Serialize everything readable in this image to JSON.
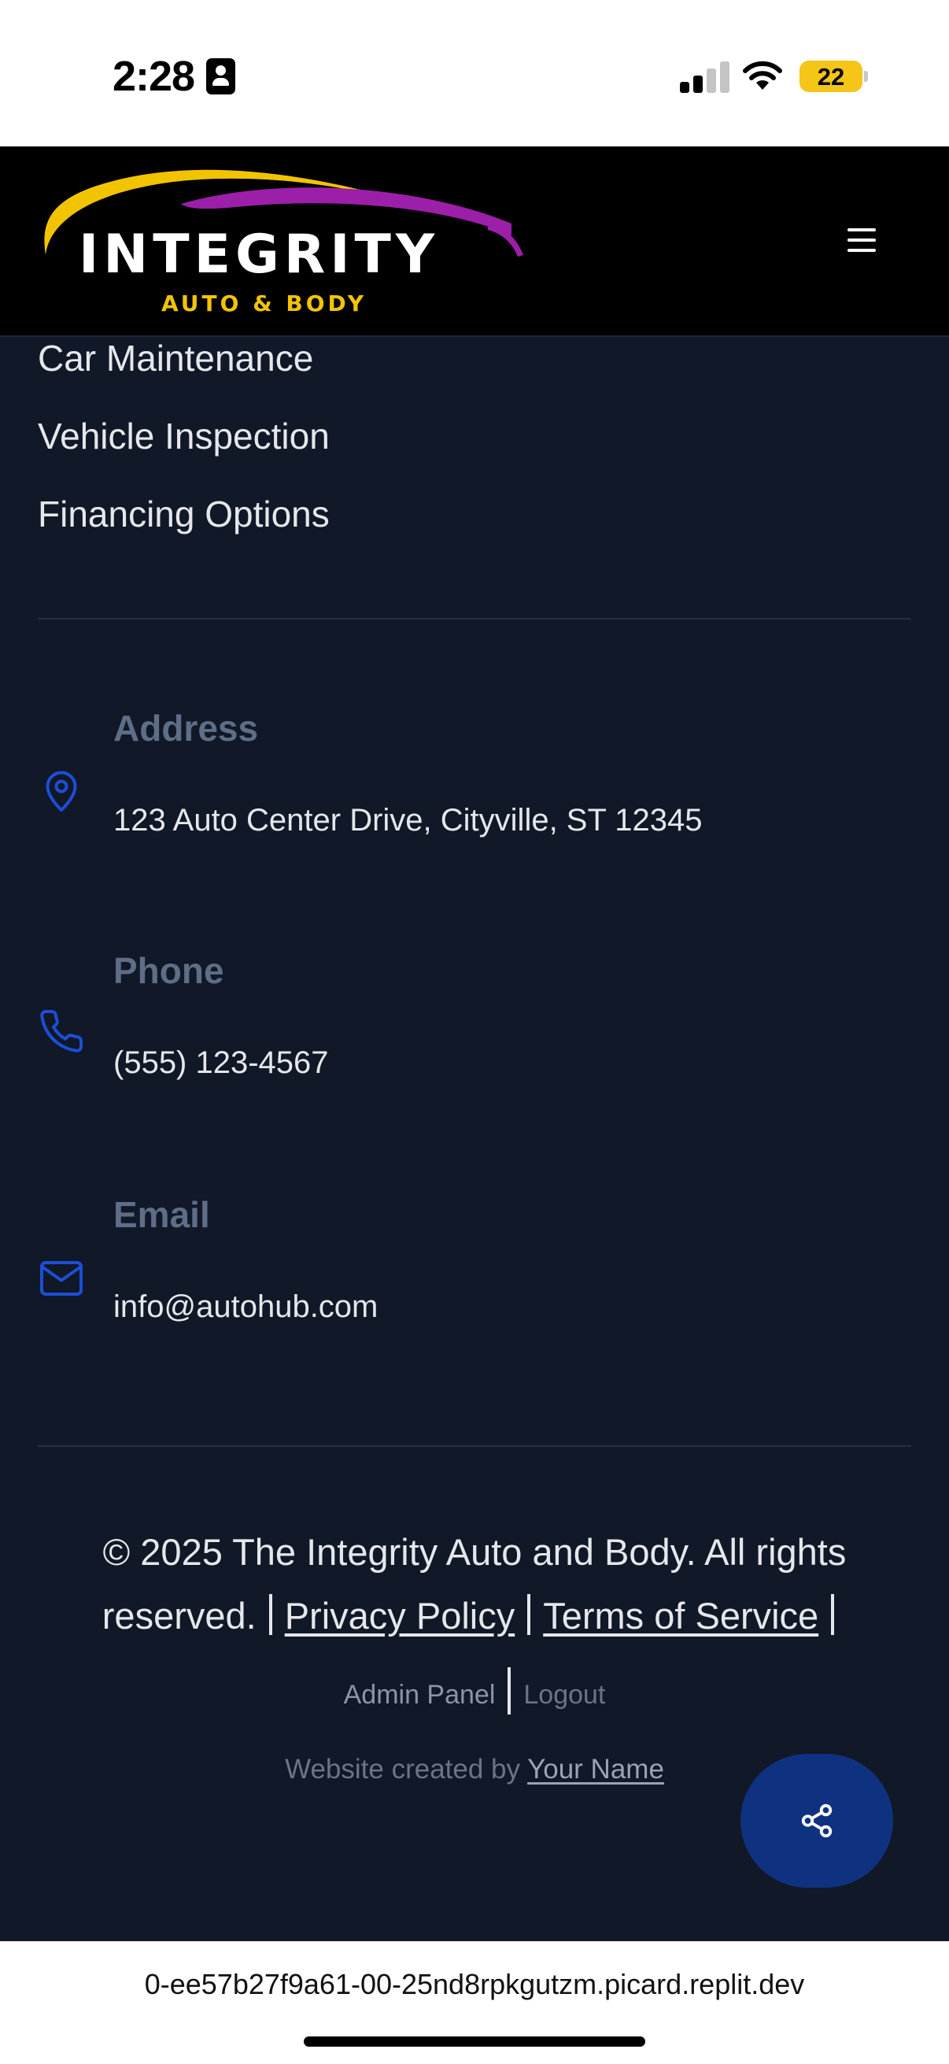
{
  "status_bar": {
    "time": "2:28",
    "battery_level": "22",
    "battery_color": "#f5c518"
  },
  "header": {
    "logo_text": "INTEGRITY",
    "logo_subtext": "AUTO & BODY",
    "logo_swoosh_colors": [
      "#f2c400",
      "#9b1fa8"
    ],
    "menu_icon": "hamburger-menu-icon"
  },
  "services": {
    "items": [
      "Car Maintenance",
      "Vehicle Inspection",
      "Financing Options"
    ]
  },
  "contact": {
    "address": {
      "label": "Address",
      "value": "123 Auto Center Drive, Cityville, ST 12345",
      "icon": "map-pin-icon"
    },
    "phone": {
      "label": "Phone",
      "value": "(555) 123-4567",
      "icon": "phone-icon"
    },
    "email": {
      "label": "Email",
      "value": "info@autohub.com",
      "icon": "mail-icon"
    }
  },
  "footer": {
    "copyright_line1": "© 2025 The Integrity Auto and Body. All rights",
    "copyright_line2": "reserved.",
    "privacy_label": "Privacy Policy",
    "terms_label": "Terms of Service",
    "admin_label": "Admin Panel",
    "logout_label": "Logout",
    "credit_prefix": "Website created by",
    "credit_name": "Your Name",
    "share_icon": "share-icon"
  },
  "browser": {
    "url": "0-ee57b27f9a61-00-25nd8rpkgutzm.picard.replit.dev"
  },
  "colors": {
    "background": "#111827",
    "header_bg": "#000000",
    "accent": "#0f3280",
    "icon_blue": "#1d4ed8",
    "label_gray": "#5f6e87"
  }
}
